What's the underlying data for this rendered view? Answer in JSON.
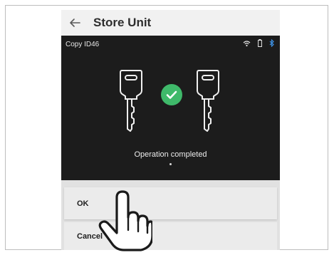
{
  "appbar": {
    "title": "Store Unit",
    "back_icon": "arrow-left-icon"
  },
  "statusbar": {
    "label": "Copy ID46",
    "icons": [
      "wifi-icon",
      "battery-icon",
      "bluetooth-icon"
    ]
  },
  "content": {
    "message": "Operation completed"
  },
  "dialog": {
    "ok_label": "OK",
    "cancel_label": "Cancel"
  },
  "colors": {
    "success": "#3fb96a",
    "bluetooth": "#3d8fe0",
    "screen": "#1c1c1c"
  }
}
